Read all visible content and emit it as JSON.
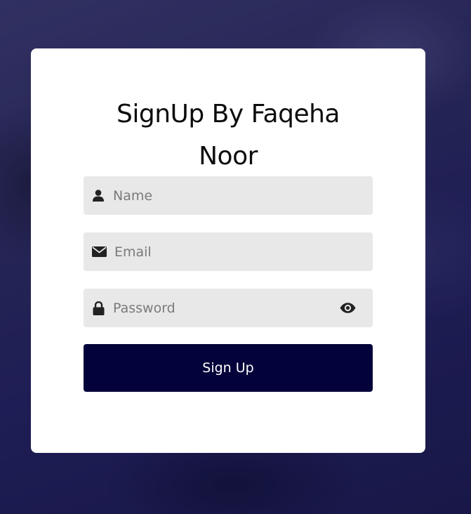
{
  "title": "SignUp By Faqeha Noor",
  "title_line1": "SignUp By Faqeha",
  "title_line2": "Noor",
  "fields": {
    "name": {
      "placeholder": "Name",
      "value": "",
      "icon": "user-icon"
    },
    "email": {
      "placeholder": "Email",
      "value": "",
      "icon": "envelope-icon"
    },
    "password": {
      "placeholder": "Password",
      "value": "",
      "icon": "lock-icon",
      "toggle_icon": "eye-icon"
    }
  },
  "submit_label": "Sign Up",
  "colors": {
    "button": "#03023a",
    "field_bg": "#e8e8e8",
    "card_bg": "#ffffff",
    "background": "#2c2b5a"
  }
}
